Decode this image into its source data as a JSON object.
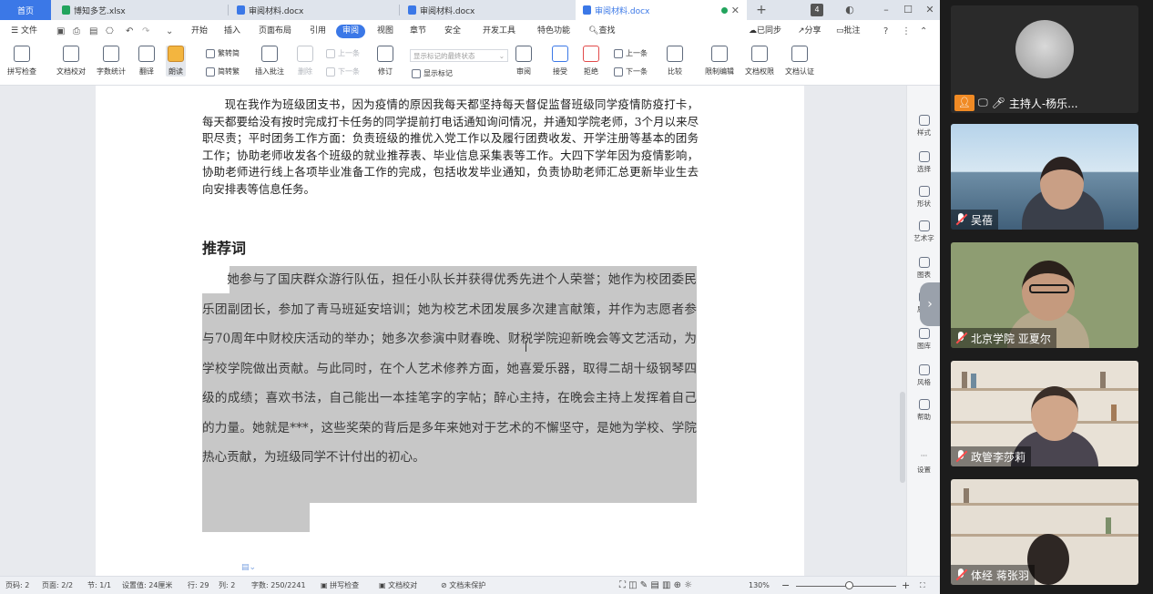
{
  "tabs": {
    "home": "首页",
    "file1": "博知多艺.xlsx",
    "file2": "审阅材料.docx",
    "file3": "审阅材料.docx",
    "file4": "审阅材料.docx",
    "new_tab": "+",
    "tab_count": "4"
  },
  "menu": {
    "file": "文件",
    "items": [
      "开始",
      "插入",
      "页面布局",
      "引用",
      "审阅",
      "视图",
      "章节",
      "安全",
      "开发工具",
      "特色功能"
    ],
    "search": "查找",
    "sync": "已同步",
    "share": "分享",
    "comment": "批注"
  },
  "ribbon": {
    "spell_check": "拼写检查",
    "doc_proof": "文档校对",
    "word_count": "字数统计",
    "translate": "翻译",
    "read_aloud": "朗读",
    "simp_to_trad": "繁转简",
    "trad_to_simp": "简转繁",
    "insert_comment": "插入批注",
    "delete": "删除",
    "prev": "上一条",
    "next": "下一条",
    "track_changes": "修订",
    "show_markup_state": "显示标记的最终状态",
    "show_markup": "显示标记",
    "review": "审阅",
    "accept": "接受",
    "reject": "拒绝",
    "prev_change": "上一条",
    "next_change": "下一条",
    "compare": "比较",
    "restrict_edit": "限制编辑",
    "doc_rights": "文档权限",
    "doc_cert": "文档认证"
  },
  "document": {
    "para1": "现在我作为班级团支书，因为疫情的原因我每天都坚持每天督促监督班级同学疫情防疫打卡，每天都要给没有按时完成打卡任务的同学提前打电话通知询问情况，并通知学院老师，3个月以来尽职尽责；平时团务工作方面：负责班级的推优入党工作以及履行团费收发、开学注册等基本的团务工作；协助老师收发各个班级的就业推荐表、毕业信息采集表等工作。大四下学年因为疫情影响，协助老师进行线上各项毕业准备工作的完成，包括收发毕业通知，负责协助老师汇总更新毕业生去向安排表等信息任务。",
    "heading": "推荐词",
    "para2": "她参与了国庆群众游行队伍，担任小队长并获得优秀先进个人荣誉；她作为校团委民乐团副团长，参加了青马班延安培训；她为校艺术团发展多次建言献策，并作为志愿者参与70周年中财校庆活动的举办；她多次参演中财春晚、财税学院迎新晚会等文艺活动，为学校学院做出贡献。与此同时，在个人艺术修养方面，她喜爱乐器，取得二胡十级钢琴四级的成绩；喜欢书法，自己能出一本挂笔字的字帖；醉心主持，在晚会主持上发挥着自己的力量。她就是***，这些奖荣的背后是多年来她对于艺术的不懈坚守，是她为学校、学院热心贡献，为班级同学不计付出的初心。"
  },
  "right_sidebar": [
    "样式",
    "选择",
    "形状",
    "艺术字",
    "图表",
    "属性",
    "图库",
    "风格",
    "帮助",
    "设置"
  ],
  "statusbar": {
    "page_num": "页码: 2",
    "pages": "页面: 2/2",
    "section": "节: 1/1",
    "setting": "设置值: 24厘米",
    "row": "行: 29",
    "col": "列: 2",
    "words": "字数: 250/2241",
    "spell": "拼写检查",
    "proof": "文档校对",
    "protect": "文档未保护",
    "zoom": "130%"
  },
  "meeting": {
    "participants": [
      {
        "name": "主持人-杨乐..."
      },
      {
        "name": "吴蓓"
      },
      {
        "name": "北京学院 亚夏尔"
      },
      {
        "name": "政管李莎莉"
      },
      {
        "name": "体经 蒋张羽"
      }
    ]
  },
  "colors": {
    "accent": "#3b78e7",
    "selection": "#c7c7c7",
    "mic_off": "#ff4d4d"
  }
}
